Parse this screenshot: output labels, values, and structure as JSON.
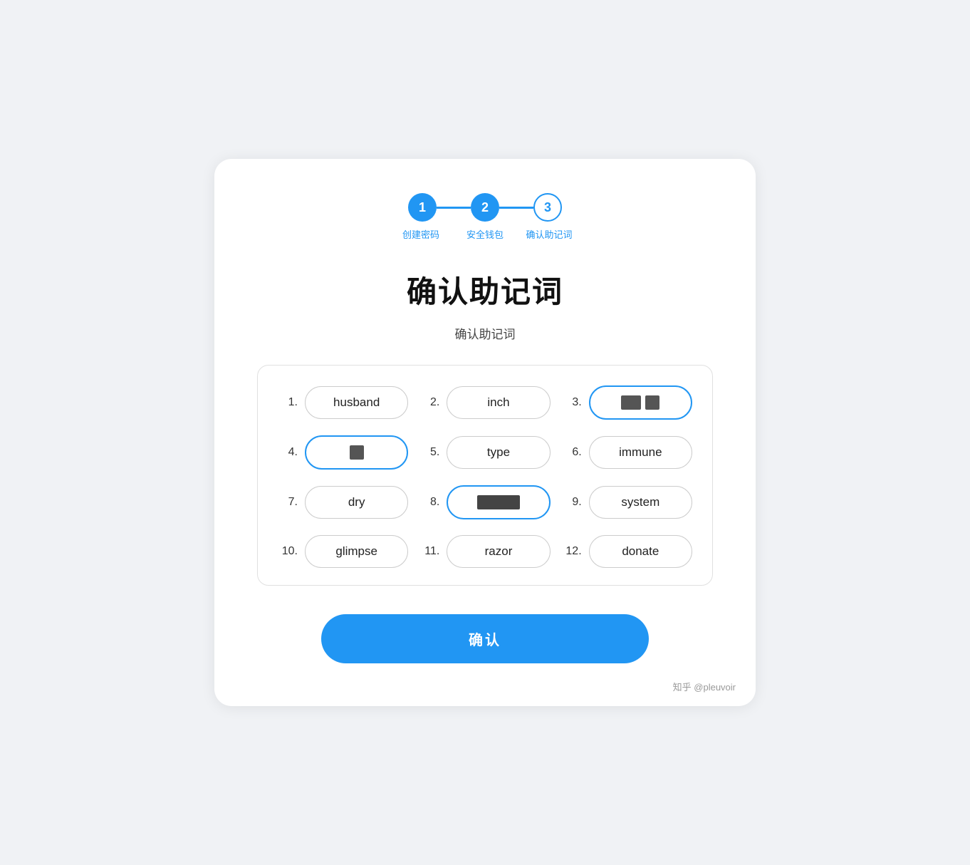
{
  "stepper": {
    "steps": [
      {
        "number": "1",
        "type": "active",
        "label": "创建密码"
      },
      {
        "number": "2",
        "type": "active",
        "label": "安全钱包"
      },
      {
        "number": "3",
        "type": "outline",
        "label": "确认助记词"
      }
    ]
  },
  "page": {
    "title": "确认助记词",
    "subtitle": "确认助记词"
  },
  "mnemonic": {
    "words": [
      {
        "number": "1.",
        "word": "husband",
        "style": "normal"
      },
      {
        "number": "2.",
        "word": "inch",
        "style": "normal"
      },
      {
        "number": "3.",
        "word": "redacted-2",
        "style": "redacted-blue"
      },
      {
        "number": "4.",
        "word": "redacted-1",
        "style": "redacted-blue"
      },
      {
        "number": "5.",
        "word": "type",
        "style": "normal"
      },
      {
        "number": "6.",
        "word": "immune",
        "style": "normal"
      },
      {
        "number": "7.",
        "word": "dry",
        "style": "normal"
      },
      {
        "number": "8.",
        "word": "redacted-lg",
        "style": "redacted-outline"
      },
      {
        "number": "9.",
        "word": "system",
        "style": "normal"
      },
      {
        "number": "10.",
        "word": "glimpse",
        "style": "normal"
      },
      {
        "number": "11.",
        "word": "razor",
        "style": "normal"
      },
      {
        "number": "12.",
        "word": "donate",
        "style": "normal"
      }
    ],
    "confirm_button": "确认"
  },
  "watermark": "知乎 @pleuvoir"
}
